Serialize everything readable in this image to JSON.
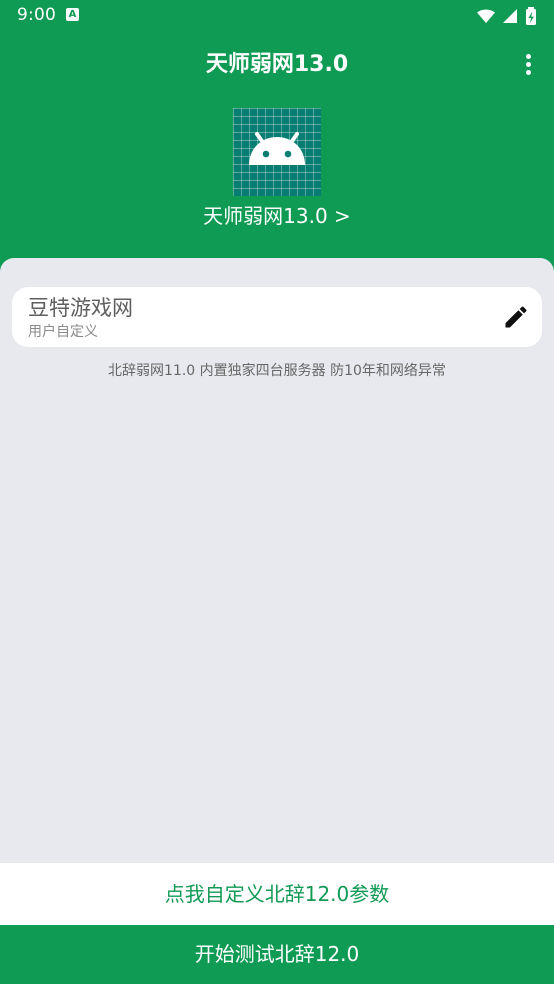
{
  "status_bar": {
    "time": "9:00",
    "notification_glyph": "A",
    "icons": [
      "wifi-icon",
      "signal-icon",
      "battery-icon"
    ]
  },
  "toolbar": {
    "title": "天师弱网13.0",
    "menu_icon": "more-vert-icon"
  },
  "header": {
    "app_icon": "android-icon",
    "app_link": "天师弱网13.0 >"
  },
  "profile_card": {
    "name": "豆特游戏网",
    "subtitle": "用户自定义",
    "edit_icon": "pencil-icon"
  },
  "description": "北辞弱网11.0 内置独家四台服务器 防10年和网络异常",
  "buttons": {
    "custom": "点我自定义北辞12.0参数",
    "start": "开始测试北辞12.0"
  },
  "colors": {
    "brand_green": "#0f9b54",
    "text_green": "#119a55",
    "page_background": "#e8e9ee",
    "android_tile": "#087e72"
  }
}
